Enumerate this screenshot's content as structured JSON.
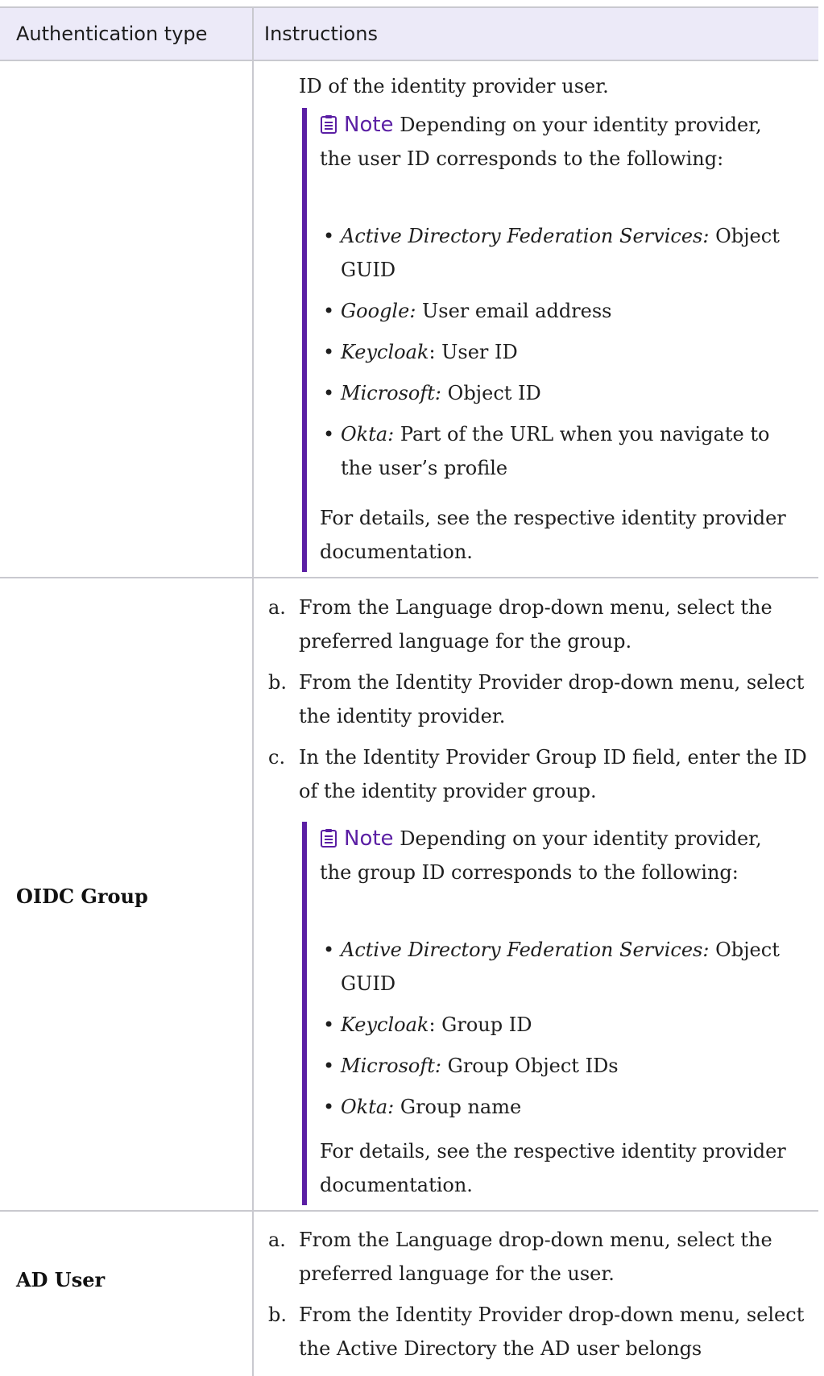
{
  "header": {
    "col1": "Authentication type",
    "col2": "Instructions"
  },
  "row1": {
    "text": "ID of the identity provider user.",
    "note": {
      "title": "Note",
      "lead": "Depending on your identity provider, the user ID corresponds to the following:",
      "items": [
        {
          "name": "Active Directory Federation Services:",
          "value": "Object GUID"
        },
        {
          "name": "Google:",
          "value": "User email address"
        },
        {
          "name": "Keycloak",
          "value": ": User ID"
        },
        {
          "name": "Microsoft:",
          "value": "Object ID"
        },
        {
          "name": "Okta:",
          "value": "Part of the URL when you navigate to the user’s profile"
        }
      ],
      "footer": "For details, see the respective identity provider documentation."
    }
  },
  "row2": {
    "label": "OIDC Group",
    "steps": [
      {
        "marker": "a.",
        "text": "From the Language drop-down menu, select the preferred language for the group."
      },
      {
        "marker": "b.",
        "text": "From the Identity Provider drop-down menu, select the identity provider."
      },
      {
        "marker": "c.",
        "text": "In the Identity Provider Group ID field, enter the ID of the identity provider group."
      }
    ],
    "note": {
      "title": "Note",
      "lead": "Depending on your identity provider, the group ID corresponds to the following:",
      "items": [
        {
          "name": "Active Directory Federation Services:",
          "value": "Object GUID"
        },
        {
          "name": "Keycloak",
          "value": ": Group ID"
        },
        {
          "name": "Microsoft:",
          "value": "Group Object IDs"
        },
        {
          "name": "Okta:",
          "value": "Group name"
        }
      ],
      "footer": "For details, see the respective identity provider documentation."
    }
  },
  "row3": {
    "label": "AD User",
    "steps": [
      {
        "marker": "a.",
        "text": "From the Language drop-down menu, select the preferred language for the user."
      },
      {
        "marker": "b.",
        "text": "From the Identity Provider drop-down menu, select the Active Directory the AD user belongs"
      }
    ]
  }
}
